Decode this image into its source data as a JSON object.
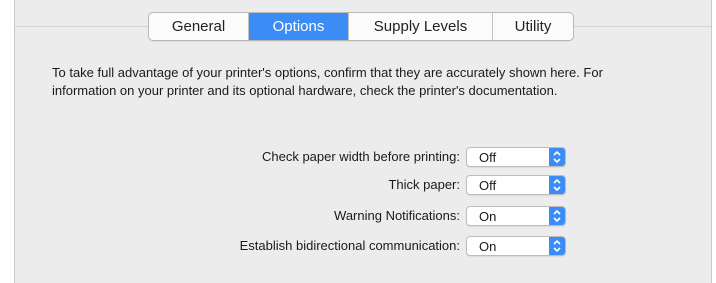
{
  "tabs": [
    {
      "label": "General",
      "active": false
    },
    {
      "label": "Options",
      "active": true
    },
    {
      "label": "Supply Levels",
      "active": false
    },
    {
      "label": "Utility",
      "active": false
    }
  ],
  "description": "To take full advantage of your printer's options, confirm that they are accurately shown here. For information on your printer and its optional hardware, check the printer's documentation.",
  "options": [
    {
      "label": "Check paper width before printing:",
      "value": "Off"
    },
    {
      "label": "Thick paper:",
      "value": "Off"
    },
    {
      "label": "Warning Notifications:",
      "value": "On"
    },
    {
      "label": "Establish bidirectional communication:",
      "value": "On"
    }
  ],
  "colors": {
    "accent": "#3c8cf6",
    "pane_background": "#ececec"
  },
  "icons": {
    "popup_arrow": "up-down-chevron-icon"
  }
}
